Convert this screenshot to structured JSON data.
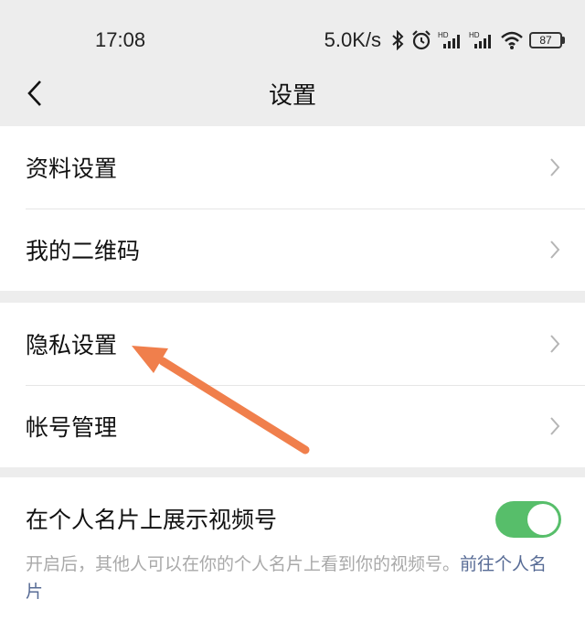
{
  "status_bar": {
    "time": "17:08",
    "net_speed": "5.0K/s",
    "battery": "87",
    "icons": [
      "bluetooth-icon",
      "alarm-icon",
      "signal-hd-icon",
      "signal-hd-icon",
      "wifi-icon",
      "battery-icon"
    ]
  },
  "nav": {
    "title": "设置",
    "back_icon": "back-chevron-icon"
  },
  "groups": [
    {
      "items": [
        {
          "label": "资料设置"
        },
        {
          "label": "我的二维码"
        }
      ]
    },
    {
      "items": [
        {
          "label": "隐私设置"
        },
        {
          "label": "帐号管理"
        }
      ]
    }
  ],
  "video_card": {
    "label": "在个人名片上展示视频号",
    "toggle_on": true,
    "toggle_color": "#57be6a",
    "description": "开启后，其他人可以在你的个人名片上看到你的视频号。",
    "link_text": "前往个人名片",
    "link_color": "#576b95"
  },
  "annotation": {
    "type": "arrow",
    "color": "#f07f4c",
    "points_to": "隐私设置"
  }
}
